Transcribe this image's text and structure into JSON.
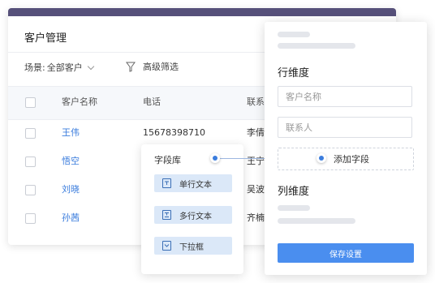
{
  "customer_card": {
    "title": "客户管理",
    "scene_label": "场景:",
    "scene_value": "全部客户",
    "advanced_filter_label": "高级筛选",
    "columns": [
      "客户名称",
      "电话",
      "联系"
    ],
    "rows": [
      {
        "name": "王伟",
        "phone": "15678398710",
        "contact": "李倩"
      },
      {
        "name": "悟空",
        "phone": "",
        "contact": "王宁"
      },
      {
        "name": "刘晓",
        "phone": "",
        "contact": "吴波"
      },
      {
        "name": "孙茜",
        "phone": "",
        "contact": "齐楠"
      }
    ]
  },
  "field_library": {
    "title": "字段库",
    "items": [
      {
        "label": "单行文本",
        "icon": "single-line-text-icon"
      },
      {
        "label": "多行文本",
        "icon": "multi-line-text-icon"
      },
      {
        "label": "下拉框",
        "icon": "dropdown-icon"
      }
    ]
  },
  "settings_panel": {
    "row_dimension_title": "行维度",
    "inputs": [
      {
        "placeholder": "客户名称"
      },
      {
        "placeholder": "联系人"
      }
    ],
    "add_field_label": "添加字段",
    "column_dimension_title": "列维度",
    "save_label": "保存设置"
  },
  "colors": {
    "accent": "#3b7ddd",
    "save_button": "#4a8eef",
    "topbar": "#56507a",
    "chip": "#dbe8f8"
  }
}
